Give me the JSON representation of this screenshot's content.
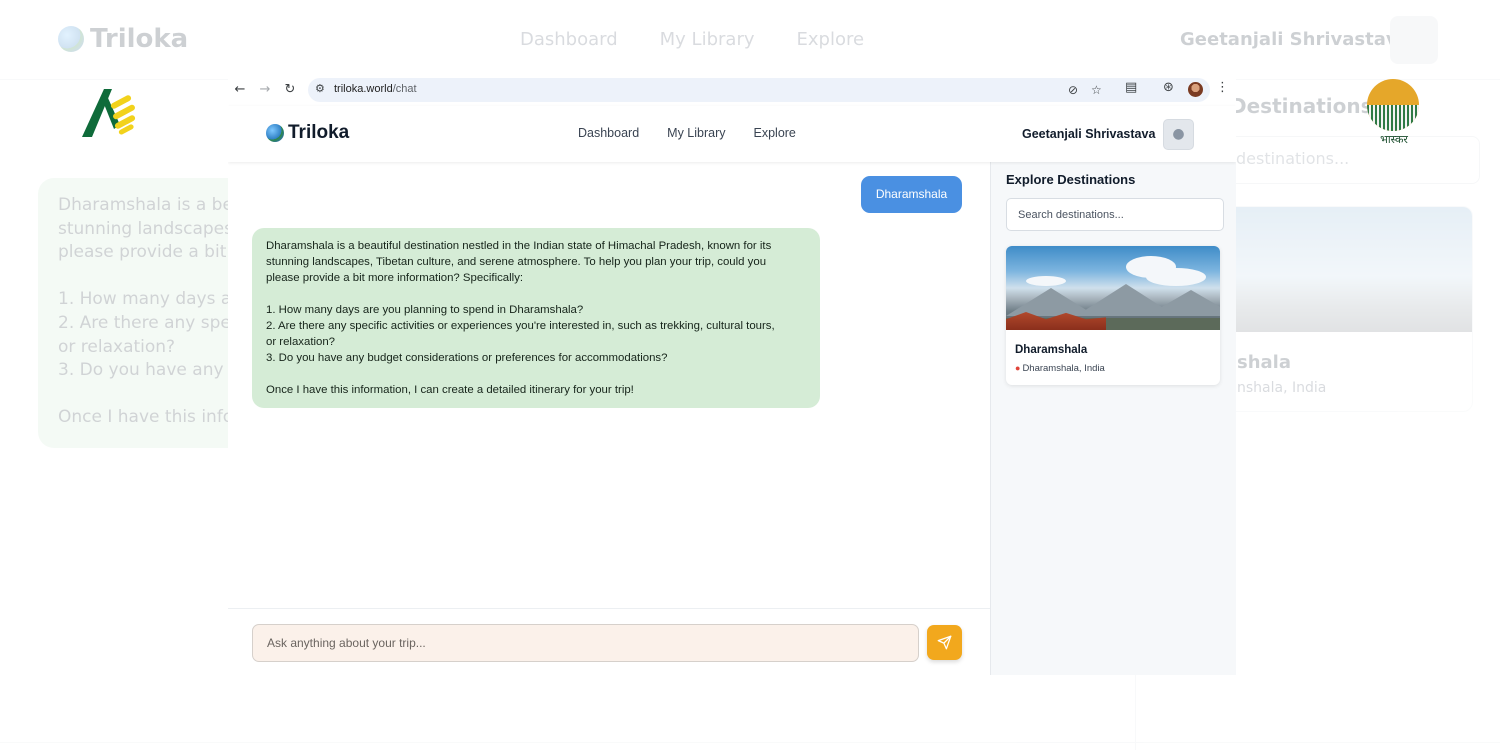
{
  "background": {
    "brand": "Triloka",
    "nav": [
      "Dashboard",
      "My Library",
      "Explore"
    ],
    "user_name": "Geetanjali Shrivastava",
    "chat_excerpt": "Dharamshala is a bea\nstunning landscapes,\nplease provide a bit m\n\n1. How many days are\n2. Are there any speci\nor relaxation?\n3. Do you have any bu\n\nOnce I have this inforn",
    "side_title": "Destinations",
    "side_search": "destinations...",
    "side_name": "shala",
    "side_loc": "nshala, India"
  },
  "logos": {
    "right_caption": "भास्कर"
  },
  "browser": {
    "url_host": "triloka.world",
    "url_path": "/chat"
  },
  "app": {
    "brand": "Triloka",
    "nav": {
      "dashboard": "Dashboard",
      "library": "My Library",
      "explore": "Explore"
    },
    "user_name": "Geetanjali Shrivastava"
  },
  "chat": {
    "user_message": "Dharamshala",
    "bot_lines": [
      "Dharamshala is a beautiful destination nestled in the Indian state of Himachal Pradesh, known for its",
      "stunning landscapes, Tibetan culture, and serene atmosphere. To help you plan your trip, could you",
      "please provide a bit more information? Specifically:",
      "",
      "1. How many days are you planning to spend in Dharamshala?",
      "2. Are there any specific activities or experiences you're interested in, such as trekking, cultural tours,",
      "or relaxation?",
      "3. Do you have any budget considerations or preferences for accommodations?",
      "",
      "Once I have this information, I can create a detailed itinerary for your trip!"
    ],
    "input_placeholder": "Ask anything about your trip..."
  },
  "panel": {
    "title": "Explore Destinations",
    "search_placeholder": "Search destinations...",
    "card": {
      "name": "Dharamshala",
      "location": "Dharamshala, India"
    }
  },
  "colors": {
    "user_bubble": "#4a90e2",
    "bot_bubble": "#d5ecd6",
    "send_button": "#f2a81d",
    "input_bg": "#fbf1ea"
  }
}
